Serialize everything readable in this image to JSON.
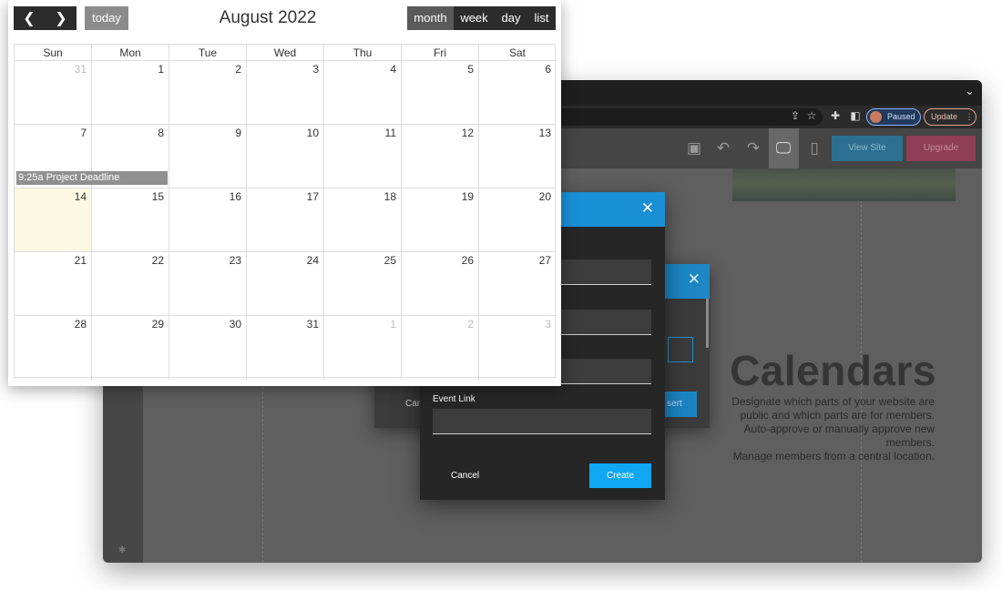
{
  "browser": {
    "toolbar_icons": [
      "share-icon",
      "star-icon",
      "puzzle-icon",
      "sidebar-icon"
    ],
    "profile": {
      "status": "Paused"
    },
    "update_label": "Update",
    "menu_glyph": "⋮",
    "chevron_glyph": "⌄"
  },
  "editor": {
    "view_site_label": "View Site",
    "upgrade_label": "Upgrade"
  },
  "page": {
    "heading": "Calendars",
    "description_lines": [
      "Designate which parts of your website are",
      "public and which parts are for members.",
      "Auto-approve or manually approve new",
      "members.",
      "Manage members from a central location."
    ]
  },
  "dialog_back": {
    "cancel_label": "Can",
    "insert_label": "sert",
    "close_glyph": "✕"
  },
  "dialog_front": {
    "close_glyph": "✕",
    "event_link_label": "Event Link",
    "event_link_value": "",
    "cancel_label": "Cancel",
    "create_label": "Create"
  },
  "calendar": {
    "prev_glyph": "❮",
    "next_glyph": "❯",
    "today_label": "today",
    "title": "August 2022",
    "views": [
      "month",
      "week",
      "day",
      "list"
    ],
    "active_view": "month",
    "weekdays": [
      "Sun",
      "Mon",
      "Tue",
      "Wed",
      "Thu",
      "Fri",
      "Sat"
    ],
    "weeks": [
      [
        31,
        1,
        2,
        3,
        4,
        5,
        6
      ],
      [
        7,
        8,
        9,
        10,
        11,
        12,
        13
      ],
      [
        14,
        15,
        16,
        17,
        18,
        19,
        20
      ],
      [
        21,
        22,
        23,
        24,
        25,
        26,
        27
      ],
      [
        28,
        29,
        30,
        31,
        1,
        2,
        3
      ]
    ],
    "today": 14,
    "event": {
      "label": "9:25a Project Deadline"
    }
  },
  "colors": {
    "accent_blue": "#1b8fd6",
    "create_blue": "#0fa6f2",
    "today_highlight": "#fcf8e3",
    "event_gray": "#909090"
  }
}
